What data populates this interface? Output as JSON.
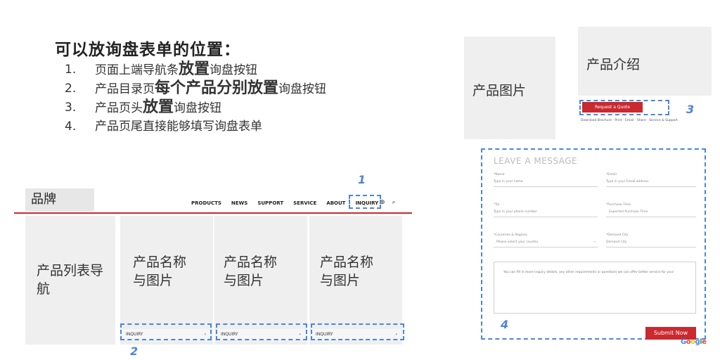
{
  "heading": "可以放询盘表单的位置：",
  "list": [
    {
      "num": "1.",
      "parts": [
        {
          "t": "页面上端导航条",
          "big": false
        },
        {
          "t": "放置",
          "big": true
        },
        {
          "t": "询盘按钮",
          "big": false
        }
      ]
    },
    {
      "num": "2.",
      "parts": [
        {
          "t": "产品目录页",
          "big": false
        },
        {
          "t": "每个产品分别放置",
          "big": true
        },
        {
          "t": "询盘按钮",
          "big": false
        }
      ]
    },
    {
      "num": "3.",
      "parts": [
        {
          "t": "产品页头",
          "big": false
        },
        {
          "t": "放置",
          "big": true
        },
        {
          "t": "询盘按钮",
          "big": false
        }
      ]
    },
    {
      "num": "4.",
      "parts": [
        {
          "t": "产品页尾直接能够填写询盘表单",
          "big": false
        }
      ]
    }
  ],
  "wireframe_list": {
    "brand": "品牌",
    "nav": [
      "PRODUCTS",
      "NEWS",
      "SUPPORT",
      "SERVICE",
      "ABOUT",
      "INQUIRY"
    ],
    "icons": [
      "globe-icon",
      "search-icon"
    ],
    "sidebar": "产品列表导航",
    "cards": [
      {
        "title": "产品名称与图片",
        "bar": "INQUIRY"
      },
      {
        "title": "产品名称与图片",
        "bar": "INQUIRY"
      },
      {
        "title": "产品名称与图片",
        "bar": "INQUIRY"
      }
    ],
    "markers": {
      "m1": "1",
      "m2": "2"
    }
  },
  "wireframe_product": {
    "image_label": "产品图片",
    "intro_label": "产品介绍",
    "quote_button": "Request a Quote",
    "links": [
      "Download Brochure",
      "Print",
      "Email",
      "Share",
      "Service & Support"
    ],
    "marker": "3"
  },
  "form": {
    "title": "LEAVE A MESSAGE",
    "fields": [
      {
        "label": "*Name",
        "placeholder": "Type in your name"
      },
      {
        "label": "*Email",
        "placeholder": "Type in your Email address"
      },
      {
        "label": "*Tel",
        "placeholder": "Type in your phone number"
      },
      {
        "label": "*Purchase Time",
        "placeholder": "Expected Purchase Time"
      },
      {
        "label": "*Countries & Regions",
        "placeholder": "Please select your country"
      },
      {
        "label": "*Demand City",
        "placeholder": "Demand City"
      }
    ],
    "message_placeholder": "You can fill in more inquiry details, any other requirements or questions we can offer better service for you!",
    "submit": "Submit Now",
    "marker": "4",
    "google": "Google"
  },
  "colors": {
    "accent_red": "#c9292f",
    "dash_blue": "#4a86d8",
    "placeholder_gray": "#efefef"
  }
}
